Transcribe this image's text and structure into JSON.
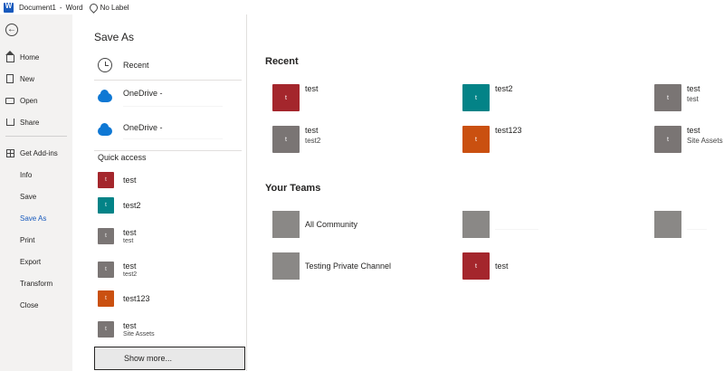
{
  "titlebar": {
    "doc_name": "Document1",
    "app_name": "Word",
    "separator": "-",
    "sensitivity_label": "No Label"
  },
  "nav": {
    "back_icon": "←",
    "items": [
      {
        "label": "Home",
        "icon": "home-icon"
      },
      {
        "label": "New",
        "icon": "new-doc-icon"
      },
      {
        "label": "Open",
        "icon": "folder-icon"
      },
      {
        "label": "Share",
        "icon": "share-icon"
      },
      {
        "label": "Get Add-ins",
        "icon": "grid-icon"
      },
      {
        "label": "Info"
      },
      {
        "label": "Save"
      },
      {
        "label": "Save As",
        "active": true
      },
      {
        "label": "Print"
      },
      {
        "label": "Export"
      },
      {
        "label": "Transform"
      },
      {
        "label": "Close"
      }
    ],
    "active_color": "#185abd"
  },
  "save_as": {
    "title": "Save As",
    "locations": [
      {
        "label": "Recent",
        "icon": "clock-icon"
      },
      {
        "label": "OneDrive -",
        "icon": "onedrive-cloud-icon"
      },
      {
        "label": "OneDrive -",
        "icon": "onedrive-cloud-icon"
      }
    ],
    "quick_access_title": "Quick access",
    "quick_access": [
      {
        "name": "test",
        "sub": "",
        "color": "#a4262c",
        "letter": "t"
      },
      {
        "name": "test2",
        "sub": "",
        "color": "#038387",
        "letter": "t"
      },
      {
        "name": "test",
        "sub": "test",
        "color": "#7a7574",
        "letter": "t"
      },
      {
        "name": "test",
        "sub": "test2",
        "color": "#7a7574",
        "letter": "t"
      },
      {
        "name": "test123",
        "sub": "",
        "color": "#ca5010",
        "letter": "t"
      },
      {
        "name": "test",
        "sub": "Site Assets",
        "color": "#7a7574",
        "letter": "t"
      }
    ],
    "show_more": "Show more..."
  },
  "recent": {
    "title": "Recent",
    "items": [
      {
        "name": "test",
        "sub": "",
        "color": "#a4262c",
        "letter": "t"
      },
      {
        "name": "test2",
        "sub": "",
        "color": "#038387",
        "letter": "t"
      },
      {
        "name": "test",
        "sub": "test",
        "color": "#7a7574",
        "letter": "t"
      },
      {
        "name": "test",
        "sub": "test2",
        "color": "#7a7574",
        "letter": "t"
      },
      {
        "name": "test123",
        "sub": "",
        "color": "#ca5010",
        "letter": "t"
      },
      {
        "name": "test",
        "sub": "Site Assets",
        "color": "#7a7574",
        "letter": "t"
      }
    ]
  },
  "teams": {
    "title": "Your Teams",
    "items": [
      {
        "name": "All Community",
        "color": "#8a8886"
      },
      {
        "name": "",
        "color": "#8a8886"
      },
      {
        "name": "",
        "color": "#8a8886"
      },
      {
        "name": "Testing Private Channel",
        "color": "#8a8886"
      },
      {
        "name": "test",
        "color": "#a4262c",
        "letter": "t"
      }
    ]
  }
}
